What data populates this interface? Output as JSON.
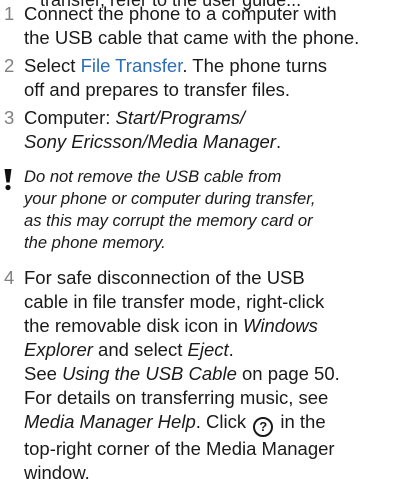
{
  "cutoff_text": "transfer, refer to the user guide...",
  "steps": [
    {
      "num": "1",
      "lines": [
        "Connect the phone to a computer with",
        "the USB cable that came with the phone."
      ]
    },
    {
      "num": "2",
      "line1_pre": "Select ",
      "line1_link": "File Transfer",
      "line1_post": ". The phone turns",
      "line2": "off and prepares to transfer files."
    },
    {
      "num": "3",
      "line1_pre": "Computer: ",
      "line1_em": "Start/Programs/",
      "line2_em": "Sony Ericsson/Media Manager",
      "line2_post": "."
    }
  ],
  "note": {
    "icon": "warning-icon",
    "lines": [
      "Do not remove the USB cable from",
      "your phone or computer during transfer,",
      "as this may corrupt the memory card or",
      "the phone memory."
    ]
  },
  "step4": {
    "num": "4",
    "l1": "For safe disconnection of the USB",
    "l2": "cable in file transfer mode, right-click",
    "l3_pre": "the removable disk icon in ",
    "l3_em": "Windows",
    "l4_em": "Explorer",
    "l4_mid": " and select ",
    "l4_em2": "Eject",
    "l4_post": ".",
    "l5_pre": "See ",
    "l5_em": "Using the USB Cable",
    "l5_post": " on page 50.",
    "l6": "For details on transferring music, see",
    "l7_em": "Media Manager Help",
    "l7_mid": ". Click ",
    "l7_icon_text": "?",
    "l7_post": " in the",
    "l8": "top-right corner of the Media Manager",
    "l9": "window."
  }
}
